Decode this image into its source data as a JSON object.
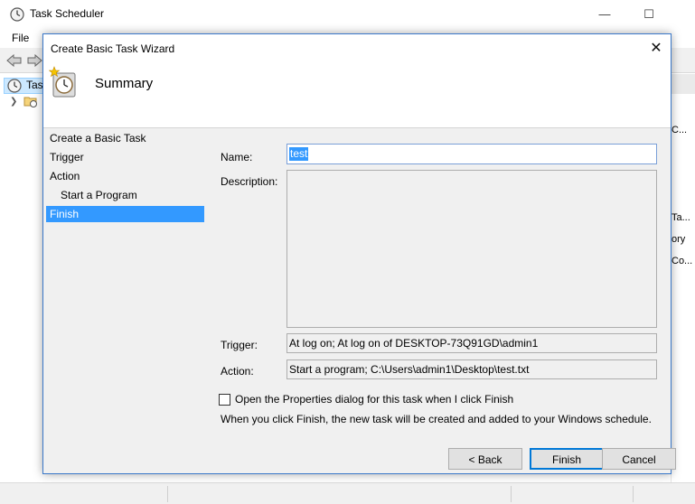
{
  "main_window": {
    "title": "Task Scheduler",
    "controls": {
      "minimize": "—",
      "maximize": "☐"
    },
    "menu": [
      "File"
    ],
    "tree": {
      "root_label": "Tas"
    },
    "right_pane": [
      "C...",
      "Ta...",
      "ory",
      "Co..."
    ]
  },
  "dialog": {
    "title": "Create Basic Task Wizard",
    "close": "✕",
    "header_title": "Summary",
    "steps": [
      {
        "label": "Create a Basic Task"
      },
      {
        "label": "Trigger"
      },
      {
        "label": "Action"
      },
      {
        "label": "Start a Program"
      },
      {
        "label": "Finish"
      }
    ],
    "fields": {
      "name_label": "Name:",
      "name_value": "test",
      "description_label": "Description:",
      "description_value": "",
      "trigger_label": "Trigger:",
      "trigger_value": "At log on; At log on of DESKTOP-73Q91GD\\admin1",
      "action_label": "Action:",
      "action_value": "Start a program; C:\\Users\\admin1\\Desktop\\test.txt"
    },
    "checkbox_label": "Open the Properties dialog for this task when I click Finish",
    "info_text": "When you click Finish, the new task will be created and added to your Windows schedule.",
    "buttons": {
      "back": "< Back",
      "finish": "Finish",
      "cancel": "Cancel"
    }
  }
}
